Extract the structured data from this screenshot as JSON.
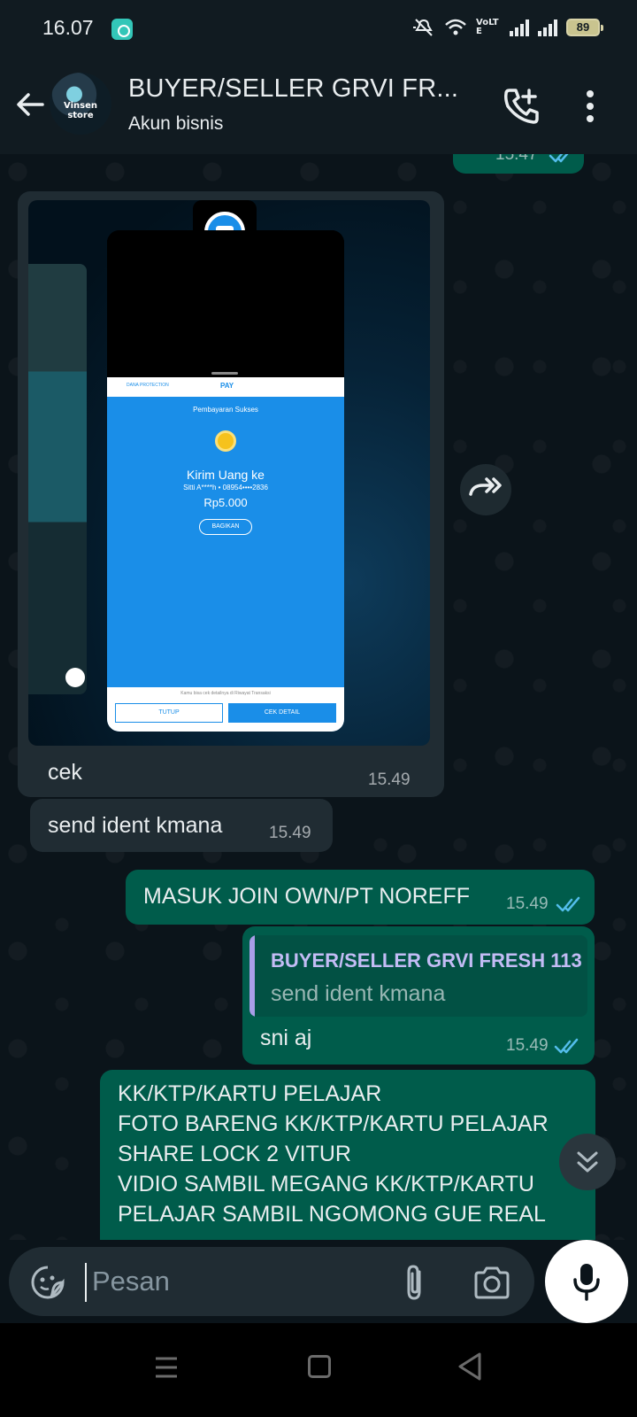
{
  "status_bar": {
    "time": "16.07",
    "network_label": "VoLTE",
    "battery": "89",
    "icons": [
      "app-notification-icon",
      "mute-icon",
      "wifi-icon",
      "volte-icon",
      "signal-icon",
      "signal-icon",
      "battery-icon"
    ]
  },
  "header": {
    "avatar_text": "Vinsen store",
    "title": "BUYER/SELLER GRVI FR...",
    "subtitle": "Akun bisnis"
  },
  "messages": [
    {
      "dir": "out",
      "text": "",
      "time": "15.47",
      "read": true
    },
    {
      "dir": "in",
      "type": "image",
      "caption": "cek",
      "time": "15.49",
      "image": {
        "sheet_label": "PAY",
        "protection_label": "DANA PROTECTION",
        "status": "Pembayaran Sukses",
        "heading": "Kirim Uang ke",
        "recipient": "Sitti A****h • 08954••••2836",
        "amount": "Rp5.000",
        "share_button": "BAGIKAN",
        "note": "Kamu bisa cek detailnya di Riwayat Transaksi",
        "close_button": "TUTUP",
        "detail_button": "CEK DETAIL"
      }
    },
    {
      "dir": "in",
      "text": "send ident kmana",
      "time": "15.49"
    },
    {
      "dir": "out",
      "text": "MASUK JOIN OWN/PT NOREFF",
      "time": "15.49",
      "read": true
    },
    {
      "dir": "out",
      "quote": {
        "author": "BUYER/SELLER GRVI FRESH 113",
        "text": "send ident kmana"
      },
      "text": "sni aj",
      "time": "15.49",
      "read": true
    },
    {
      "dir": "out",
      "text": "KK/KTP/KARTU PELAJAR\nFOTO BARENG KK/KTP/KARTU PELAJAR\nSHARE LOCK 2 VITUR\nVIDIO SAMBIL MEGANG KK/KTP/KARTU\nPELAJAR SAMBIL NGOMONG GUE REAL"
    }
  ],
  "input": {
    "placeholder": "Pesan",
    "value": ""
  },
  "colors": {
    "background": "#0b141a",
    "incoming": "#202c33",
    "outgoing": "#005c4b",
    "read_ticks": "#53bdeb",
    "quote_bar": "#a99ee8"
  }
}
